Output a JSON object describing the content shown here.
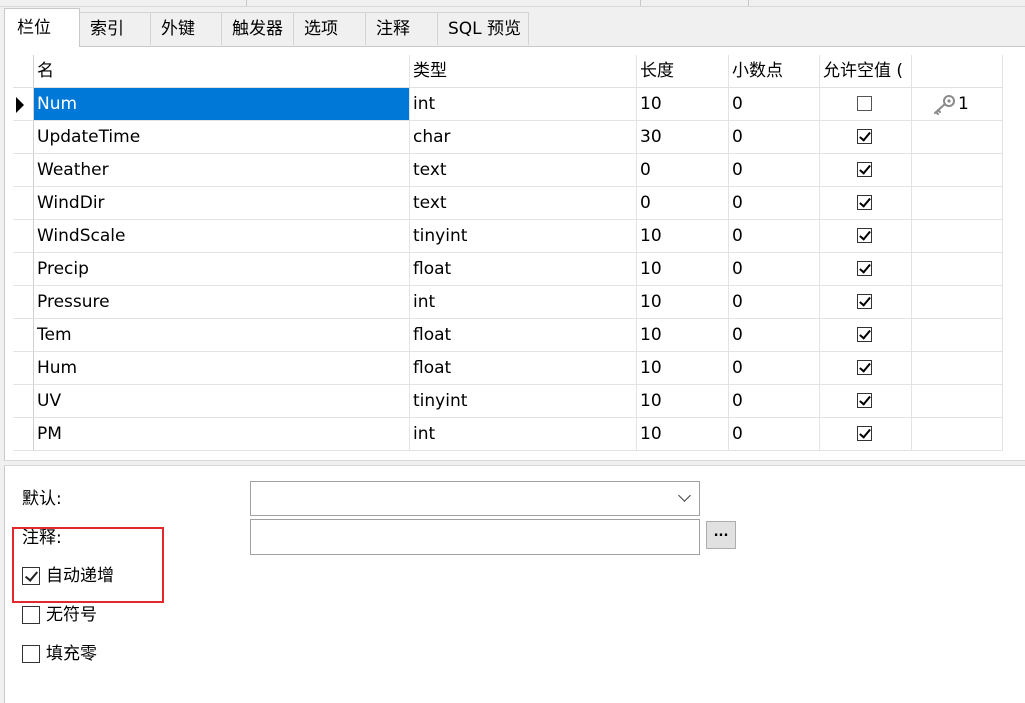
{
  "tabs": [
    {
      "label": "栏位",
      "active": true
    },
    {
      "label": "索引",
      "active": false
    },
    {
      "label": "外键",
      "active": false
    },
    {
      "label": "触发器",
      "active": false
    },
    {
      "label": "选项",
      "active": false
    },
    {
      "label": "注释",
      "active": false
    },
    {
      "label": "SQL 预览",
      "active": false
    }
  ],
  "grid": {
    "headers": {
      "name": "名",
      "type": "类型",
      "length": "长度",
      "decimals": "小数点",
      "nullable": "允许空值 (",
      "key": ""
    },
    "rows": [
      {
        "name": "Num",
        "type": "int",
        "length": "10",
        "decimals": "0",
        "nullable": false,
        "key": "1",
        "selected": true
      },
      {
        "name": "UpdateTime",
        "type": "char",
        "length": "30",
        "decimals": "0",
        "nullable": true,
        "key": ""
      },
      {
        "name": "Weather",
        "type": "text",
        "length": "0",
        "decimals": "0",
        "nullable": true,
        "key": ""
      },
      {
        "name": "WindDir",
        "type": "text",
        "length": "0",
        "decimals": "0",
        "nullable": true,
        "key": ""
      },
      {
        "name": "WindScale",
        "type": "tinyint",
        "length": "10",
        "decimals": "0",
        "nullable": true,
        "key": ""
      },
      {
        "name": "Precip",
        "type": "float",
        "length": "10",
        "decimals": "0",
        "nullable": true,
        "key": ""
      },
      {
        "name": "Pressure",
        "type": "int",
        "length": "10",
        "decimals": "0",
        "nullable": true,
        "key": ""
      },
      {
        "name": "Tem",
        "type": "float",
        "length": "10",
        "decimals": "0",
        "nullable": true,
        "key": ""
      },
      {
        "name": "Hum",
        "type": "float",
        "length": "10",
        "decimals": "0",
        "nullable": true,
        "key": ""
      },
      {
        "name": "UV",
        "type": "tinyint",
        "length": "10",
        "decimals": "0",
        "nullable": true,
        "key": ""
      },
      {
        "name": "PM",
        "type": "int",
        "length": "10",
        "decimals": "0",
        "nullable": true,
        "key": ""
      }
    ]
  },
  "form": {
    "default_label": "默认:",
    "default_value": "",
    "comment_label": "注释:",
    "comment_value": "",
    "ellipsis_label": "...",
    "options": [
      {
        "label": "自动递增",
        "checked": true
      },
      {
        "label": "无符号",
        "checked": false
      },
      {
        "label": "填充零",
        "checked": false
      }
    ]
  },
  "icons": {
    "key": "primary-key-icon",
    "row_indicator": "row-pointer-icon"
  },
  "colors": {
    "selection": "#0078d7",
    "highlight": "#e3272d"
  }
}
